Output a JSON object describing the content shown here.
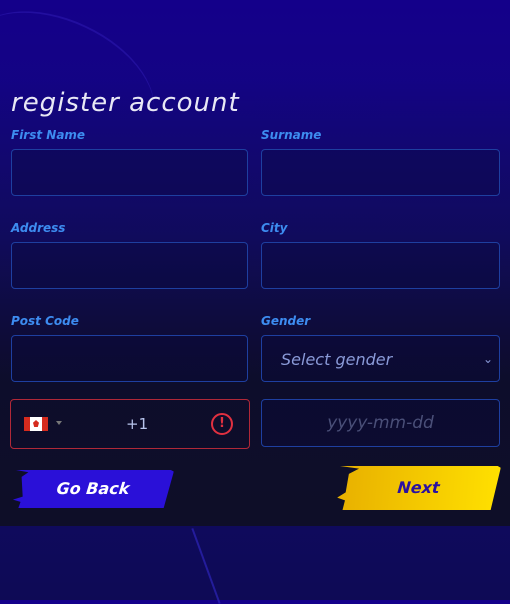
{
  "title": "register account",
  "fields": {
    "first_name": {
      "label": "First Name",
      "value": ""
    },
    "surname": {
      "label": "Surname",
      "value": ""
    },
    "address": {
      "label": "Address",
      "value": ""
    },
    "city": {
      "label": "City",
      "value": ""
    },
    "post_code": {
      "label": "Post Code",
      "value": ""
    },
    "gender": {
      "label": "Gender",
      "selected": "Select gender"
    },
    "phone": {
      "country": "Canada",
      "dial_code": "+1",
      "value": "",
      "status": "error"
    },
    "dob": {
      "placeholder": "yyyy-mm-dd",
      "value": ""
    }
  },
  "buttons": {
    "back": "Go Back",
    "next": "Next"
  },
  "icons": {
    "flag": "canada-flag-icon",
    "caret": "caret-down-icon",
    "warning": "!",
    "chevron": "⌄"
  },
  "colors": {
    "label": "#3d8cf0",
    "error": "#e03040",
    "back_btn": "#2a10d8",
    "next_btn": "#ffd400"
  }
}
